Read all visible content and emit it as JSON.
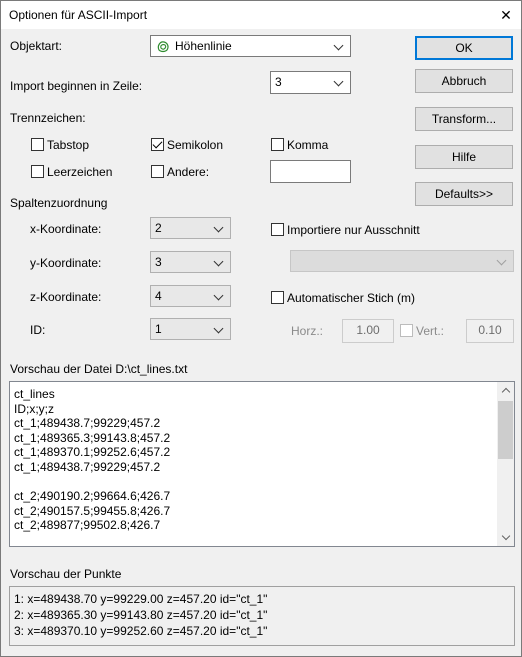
{
  "window": {
    "title": "Optionen für ASCII-Import",
    "close_glyph": "✕"
  },
  "objektart": {
    "label": "Objektart:",
    "value": "Höhenlinie",
    "icon": "contour-line-icon"
  },
  "import_zeile": {
    "label": "Import beginnen in Zeile:",
    "value": "3"
  },
  "trennzeichen": {
    "label": "Trennzeichen:",
    "tabstop": {
      "label": "Tabstop",
      "checked": false
    },
    "semikolon": {
      "label": "Semikolon",
      "checked": true
    },
    "komma": {
      "label": "Komma",
      "checked": false
    },
    "leerzeichen": {
      "label": "Leerzeichen",
      "checked": false
    },
    "andere": {
      "label": "Andere:",
      "checked": false,
      "value": ""
    }
  },
  "spalten": {
    "label": "Spaltenzuordnung",
    "x": {
      "label": "x-Koordinate:",
      "value": "2"
    },
    "y": {
      "label": "y-Koordinate:",
      "value": "3"
    },
    "z": {
      "label": "z-Koordinate:",
      "value": "4"
    },
    "id": {
      "label": "ID:",
      "value": "1"
    }
  },
  "ausschnitt": {
    "label": "Importiere nur Ausschnitt",
    "checked": false,
    "value": ""
  },
  "stich": {
    "label": "Automatischer Stich (m)",
    "checked": false,
    "horz_label": "Horz.:",
    "horz_value": "1.00",
    "vert_label": "Vert.:",
    "vert_value": "0.10"
  },
  "buttons": {
    "ok": "OK",
    "abbruch": "Abbruch",
    "transform": "Transform...",
    "hilfe": "Hilfe",
    "defaults": "Defaults>>"
  },
  "datei_vorschau": {
    "label": "Vorschau der Datei D:\\ct_lines.txt",
    "lines": [
      "ct_lines",
      "ID;x;y;z",
      "ct_1;489438.7;99229;457.2",
      "ct_1;489365.3;99143.8;457.2",
      "ct_1;489370.1;99252.6;457.2",
      "ct_1;489438.7;99229;457.2",
      "",
      "ct_2;490190.2;99664.6;426.7",
      "ct_2;490157.5;99455.8;426.7",
      "ct_2;489877;99502.8;426.7"
    ]
  },
  "punkte_vorschau": {
    "label": "Vorschau der Punkte",
    "lines": [
      "1: x=489438.70 y=99229.00 z=457.20 id=\"ct_1\"",
      "2: x=489365.30 y=99143.80 z=457.20 id=\"ct_1\"",
      "3: x=489370.10 y=99252.60 z=457.20 id=\"ct_1\""
    ]
  }
}
